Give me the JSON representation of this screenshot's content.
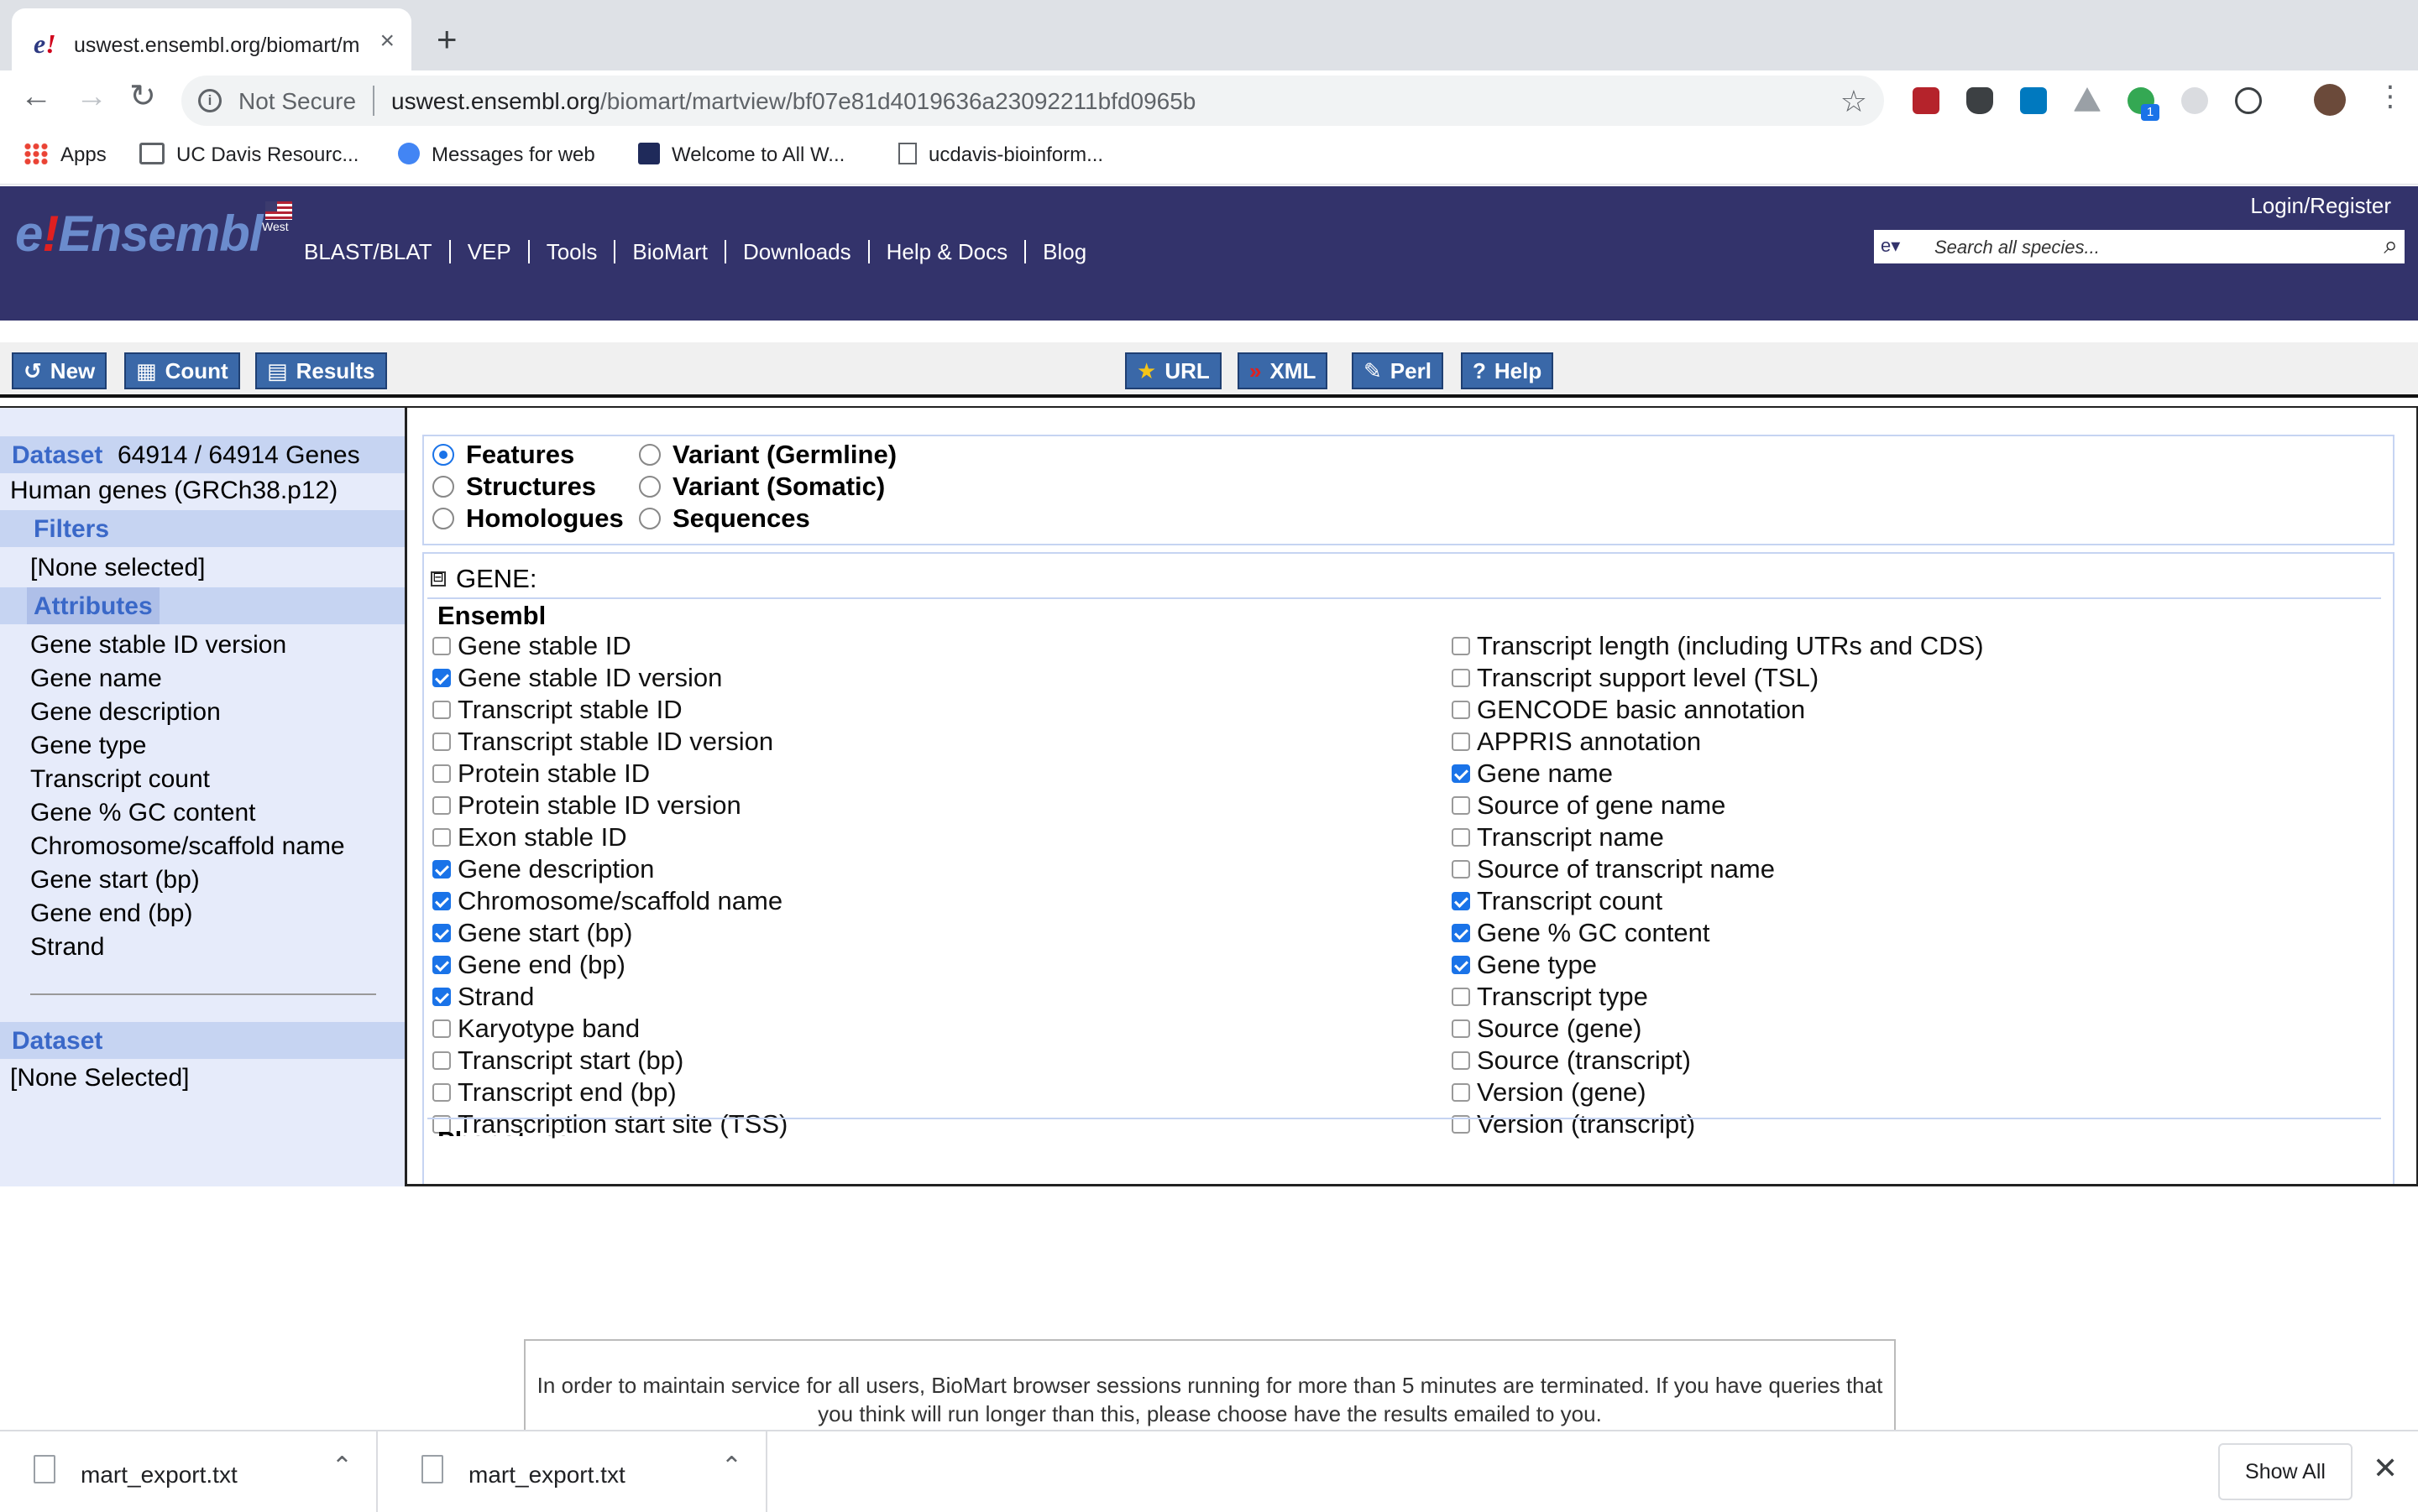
{
  "browser": {
    "tab_title": "uswest.ensembl.org/biomart/m",
    "new_tab": "+",
    "not_secure": "Not Secure",
    "url_host": "uswest.ensembl.org",
    "url_path": "/biomart/martview/bf07e81d4019636a23092211bfd0965b",
    "bookmarks": [
      "Apps",
      "UC Davis Resourc...",
      "Messages for web",
      "Welcome to All W...",
      "ucdavis-bioinform..."
    ],
    "extension_badge": "1"
  },
  "ensembl": {
    "logo": "Ensembl",
    "logo_e": "e",
    "logo_bang": "!",
    "flag_label": "West",
    "nav": [
      "BLAST/BLAT",
      "VEP",
      "Tools",
      "BioMart",
      "Downloads",
      "Help & Docs",
      "Blog"
    ],
    "login": "Login/Register",
    "search_placeholder": "Search all species..."
  },
  "actions": {
    "left": [
      "New",
      "Count",
      "Results"
    ],
    "right": [
      "URL",
      "XML",
      "Perl",
      "Help"
    ]
  },
  "sidebar": {
    "dataset_label": "Dataset",
    "dataset_count": "64914 / 64914 Genes",
    "dataset_name": "Human genes (GRCh38.p12)",
    "filters_label": "Filters",
    "filters_value": "[None selected]",
    "attributes_label": "Attributes",
    "attributes": [
      "Gene stable ID version",
      "Gene name",
      "Gene description",
      "Gene type",
      "Transcript count",
      "Gene % GC content",
      "Chromosome/scaffold name",
      "Gene start (bp)",
      "Gene end (bp)",
      "Strand"
    ],
    "dataset2_label": "Dataset",
    "dataset2_value": "[None Selected]"
  },
  "attribute_types": {
    "col1": [
      {
        "label": "Features",
        "selected": true
      },
      {
        "label": "Structures",
        "selected": false
      },
      {
        "label": "Homologues",
        "selected": false
      }
    ],
    "col2": [
      {
        "label": "Variant (Germline)",
        "selected": false
      },
      {
        "label": "Variant (Somatic)",
        "selected": false
      },
      {
        "label": "Sequences",
        "selected": false
      }
    ]
  },
  "gene_section": {
    "toggle": "⊟",
    "title": "GENE:",
    "subheading": "Ensembl",
    "left": [
      {
        "label": "Gene stable ID",
        "checked": false
      },
      {
        "label": "Gene stable ID version",
        "checked": true
      },
      {
        "label": "Transcript stable ID",
        "checked": false
      },
      {
        "label": "Transcript stable ID version",
        "checked": false
      },
      {
        "label": "Protein stable ID",
        "checked": false
      },
      {
        "label": "Protein stable ID version",
        "checked": false
      },
      {
        "label": "Exon stable ID",
        "checked": false
      },
      {
        "label": "Gene description",
        "checked": true
      },
      {
        "label": "Chromosome/scaffold name",
        "checked": true
      },
      {
        "label": "Gene start (bp)",
        "checked": true
      },
      {
        "label": "Gene end (bp)",
        "checked": true
      },
      {
        "label": "Strand",
        "checked": true
      },
      {
        "label": "Karyotype band",
        "checked": false
      },
      {
        "label": "Transcript start (bp)",
        "checked": false
      },
      {
        "label": "Transcript end (bp)",
        "checked": false
      },
      {
        "label": "Transcription start site (TSS)",
        "checked": false
      }
    ],
    "right": [
      {
        "label": "Transcript length (including UTRs and CDS)",
        "checked": false
      },
      {
        "label": "Transcript support level (TSL)",
        "checked": false
      },
      {
        "label": "GENCODE basic annotation",
        "checked": false
      },
      {
        "label": "APPRIS annotation",
        "checked": false
      },
      {
        "label": "Gene name",
        "checked": true
      },
      {
        "label": "Source of gene name",
        "checked": false
      },
      {
        "label": "Transcript name",
        "checked": false
      },
      {
        "label": "Source of transcript name",
        "checked": false
      },
      {
        "label": "Transcript count",
        "checked": true
      },
      {
        "label": "Gene % GC content",
        "checked": true
      },
      {
        "label": "Gene type",
        "checked": true
      },
      {
        "label": "Transcript type",
        "checked": false
      },
      {
        "label": "Source (gene)",
        "checked": false
      },
      {
        "label": "Source (transcript)",
        "checked": false
      },
      {
        "label": "Version (gene)",
        "checked": false
      },
      {
        "label": "Version (transcript)",
        "checked": false
      }
    ],
    "next_heading": "Phenotype"
  },
  "notice": "In order to maintain service for all users, BioMart browser sessions running for more than 5 minutes are terminated. If you have queries that you think will run longer than this, please choose have the results emailed to you.",
  "downloads": {
    "items": [
      "mart_export.txt",
      "mart_export.txt"
    ],
    "show_all": "Show All"
  },
  "colors": {
    "ensembl_header": "#33336b",
    "biomart_button": "#3a68a8",
    "sidebar_bg": "#e6ebfa",
    "sidebar_heading": "#c6d4f2",
    "checkbox_on": "#1a73e8"
  }
}
